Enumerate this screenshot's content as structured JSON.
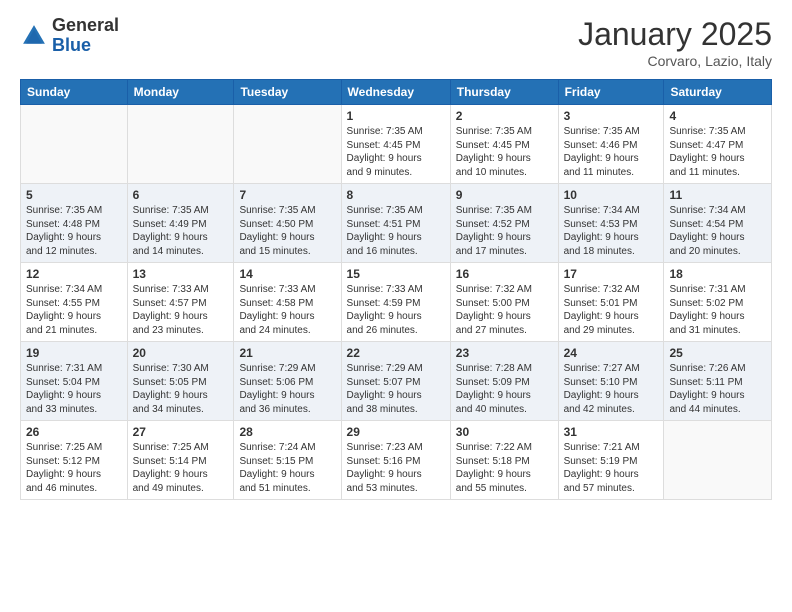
{
  "header": {
    "logo_general": "General",
    "logo_blue": "Blue",
    "month": "January 2025",
    "location": "Corvaro, Lazio, Italy"
  },
  "days_of_week": [
    "Sunday",
    "Monday",
    "Tuesday",
    "Wednesday",
    "Thursday",
    "Friday",
    "Saturday"
  ],
  "weeks": [
    [
      {
        "day": "",
        "info": ""
      },
      {
        "day": "",
        "info": ""
      },
      {
        "day": "",
        "info": ""
      },
      {
        "day": "1",
        "info": "Sunrise: 7:35 AM\nSunset: 4:45 PM\nDaylight: 9 hours\nand 9 minutes."
      },
      {
        "day": "2",
        "info": "Sunrise: 7:35 AM\nSunset: 4:45 PM\nDaylight: 9 hours\nand 10 minutes."
      },
      {
        "day": "3",
        "info": "Sunrise: 7:35 AM\nSunset: 4:46 PM\nDaylight: 9 hours\nand 11 minutes."
      },
      {
        "day": "4",
        "info": "Sunrise: 7:35 AM\nSunset: 4:47 PM\nDaylight: 9 hours\nand 11 minutes."
      }
    ],
    [
      {
        "day": "5",
        "info": "Sunrise: 7:35 AM\nSunset: 4:48 PM\nDaylight: 9 hours\nand 12 minutes."
      },
      {
        "day": "6",
        "info": "Sunrise: 7:35 AM\nSunset: 4:49 PM\nDaylight: 9 hours\nand 14 minutes."
      },
      {
        "day": "7",
        "info": "Sunrise: 7:35 AM\nSunset: 4:50 PM\nDaylight: 9 hours\nand 15 minutes."
      },
      {
        "day": "8",
        "info": "Sunrise: 7:35 AM\nSunset: 4:51 PM\nDaylight: 9 hours\nand 16 minutes."
      },
      {
        "day": "9",
        "info": "Sunrise: 7:35 AM\nSunset: 4:52 PM\nDaylight: 9 hours\nand 17 minutes."
      },
      {
        "day": "10",
        "info": "Sunrise: 7:34 AM\nSunset: 4:53 PM\nDaylight: 9 hours\nand 18 minutes."
      },
      {
        "day": "11",
        "info": "Sunrise: 7:34 AM\nSunset: 4:54 PM\nDaylight: 9 hours\nand 20 minutes."
      }
    ],
    [
      {
        "day": "12",
        "info": "Sunrise: 7:34 AM\nSunset: 4:55 PM\nDaylight: 9 hours\nand 21 minutes."
      },
      {
        "day": "13",
        "info": "Sunrise: 7:33 AM\nSunset: 4:57 PM\nDaylight: 9 hours\nand 23 minutes."
      },
      {
        "day": "14",
        "info": "Sunrise: 7:33 AM\nSunset: 4:58 PM\nDaylight: 9 hours\nand 24 minutes."
      },
      {
        "day": "15",
        "info": "Sunrise: 7:33 AM\nSunset: 4:59 PM\nDaylight: 9 hours\nand 26 minutes."
      },
      {
        "day": "16",
        "info": "Sunrise: 7:32 AM\nSunset: 5:00 PM\nDaylight: 9 hours\nand 27 minutes."
      },
      {
        "day": "17",
        "info": "Sunrise: 7:32 AM\nSunset: 5:01 PM\nDaylight: 9 hours\nand 29 minutes."
      },
      {
        "day": "18",
        "info": "Sunrise: 7:31 AM\nSunset: 5:02 PM\nDaylight: 9 hours\nand 31 minutes."
      }
    ],
    [
      {
        "day": "19",
        "info": "Sunrise: 7:31 AM\nSunset: 5:04 PM\nDaylight: 9 hours\nand 33 minutes."
      },
      {
        "day": "20",
        "info": "Sunrise: 7:30 AM\nSunset: 5:05 PM\nDaylight: 9 hours\nand 34 minutes."
      },
      {
        "day": "21",
        "info": "Sunrise: 7:29 AM\nSunset: 5:06 PM\nDaylight: 9 hours\nand 36 minutes."
      },
      {
        "day": "22",
        "info": "Sunrise: 7:29 AM\nSunset: 5:07 PM\nDaylight: 9 hours\nand 38 minutes."
      },
      {
        "day": "23",
        "info": "Sunrise: 7:28 AM\nSunset: 5:09 PM\nDaylight: 9 hours\nand 40 minutes."
      },
      {
        "day": "24",
        "info": "Sunrise: 7:27 AM\nSunset: 5:10 PM\nDaylight: 9 hours\nand 42 minutes."
      },
      {
        "day": "25",
        "info": "Sunrise: 7:26 AM\nSunset: 5:11 PM\nDaylight: 9 hours\nand 44 minutes."
      }
    ],
    [
      {
        "day": "26",
        "info": "Sunrise: 7:25 AM\nSunset: 5:12 PM\nDaylight: 9 hours\nand 46 minutes."
      },
      {
        "day": "27",
        "info": "Sunrise: 7:25 AM\nSunset: 5:14 PM\nDaylight: 9 hours\nand 49 minutes."
      },
      {
        "day": "28",
        "info": "Sunrise: 7:24 AM\nSunset: 5:15 PM\nDaylight: 9 hours\nand 51 minutes."
      },
      {
        "day": "29",
        "info": "Sunrise: 7:23 AM\nSunset: 5:16 PM\nDaylight: 9 hours\nand 53 minutes."
      },
      {
        "day": "30",
        "info": "Sunrise: 7:22 AM\nSunset: 5:18 PM\nDaylight: 9 hours\nand 55 minutes."
      },
      {
        "day": "31",
        "info": "Sunrise: 7:21 AM\nSunset: 5:19 PM\nDaylight: 9 hours\nand 57 minutes."
      },
      {
        "day": "",
        "info": ""
      }
    ]
  ]
}
